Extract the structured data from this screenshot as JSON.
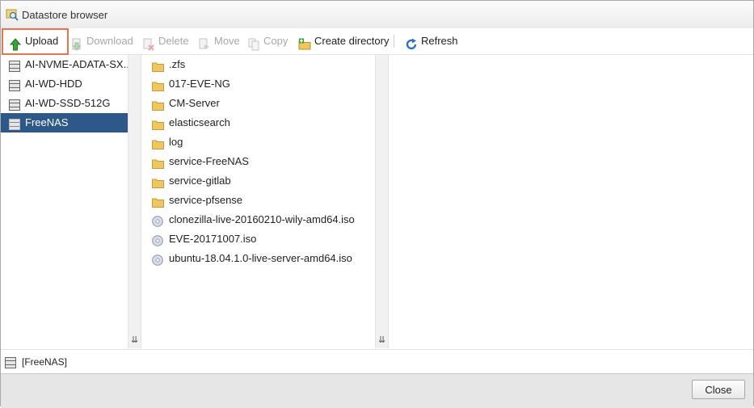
{
  "window": {
    "title": "Datastore browser",
    "title_icon": "datastore-browser-icon"
  },
  "toolbar": {
    "upload": {
      "label": "Upload",
      "icon": "upload-arrow-icon",
      "enabled": true,
      "highlight_color": "#e8734f"
    },
    "download": {
      "label": "Download",
      "icon": "download-icon",
      "enabled": false
    },
    "delete": {
      "label": "Delete",
      "icon": "delete-icon",
      "enabled": false
    },
    "move": {
      "label": "Move",
      "icon": "move-icon",
      "enabled": false
    },
    "copy": {
      "label": "Copy",
      "icon": "copy-icon",
      "enabled": false
    },
    "create_directory": {
      "label": "Create directory",
      "icon": "folder-add-icon",
      "enabled": true
    },
    "refresh": {
      "label": "Refresh",
      "icon": "refresh-icon",
      "enabled": true
    }
  },
  "datastores": [
    {
      "name": "AI-NVME-ADATA-SX...",
      "selected": false
    },
    {
      "name": "AI-WD-HDD",
      "selected": false
    },
    {
      "name": "AI-WD-SSD-512G",
      "selected": false
    },
    {
      "name": "FreeNAS",
      "selected": true
    }
  ],
  "files": [
    {
      "name": ".zfs",
      "type": "folder"
    },
    {
      "name": "017-EVE-NG",
      "type": "folder"
    },
    {
      "name": "CM-Server",
      "type": "folder"
    },
    {
      "name": "elasticsearch",
      "type": "folder"
    },
    {
      "name": "log",
      "type": "folder"
    },
    {
      "name": "service-FreeNAS",
      "type": "folder"
    },
    {
      "name": "service-gitlab",
      "type": "folder"
    },
    {
      "name": "service-pfsense",
      "type": "folder"
    },
    {
      "name": "clonezilla-live-20160210-wily-amd64.iso",
      "type": "iso"
    },
    {
      "name": "EVE-20171007.iso",
      "type": "iso"
    },
    {
      "name": "ubuntu-18.04.1.0-live-server-amd64.iso",
      "type": "iso"
    }
  ],
  "status": {
    "path": "[FreeNAS]"
  },
  "footer": {
    "close_label": "Close"
  },
  "colors": {
    "selection": "#2d5887",
    "folder": "#f0c75e",
    "accent_red": "#e8734f"
  }
}
